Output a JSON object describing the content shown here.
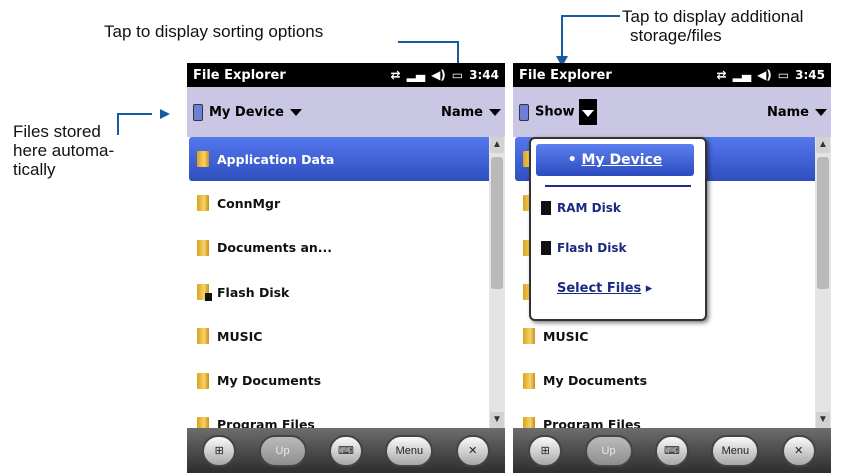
{
  "callouts": {
    "sorting": "Tap to display sorting options",
    "storage_line1": "Tap to display additional",
    "storage_line2": "storage/files",
    "files_line1": "Files stored",
    "files_line2": "here automa-",
    "files_line3": "tically"
  },
  "left_screen": {
    "app_title": "File Explorer",
    "clock": "3:44",
    "location": "My Device",
    "sort": "Name",
    "items": [
      "Application Data",
      "ConnMgr",
      "Documents an...",
      "Flash Disk",
      "MUSIC",
      "My Documents",
      "Program Files"
    ]
  },
  "right_screen": {
    "app_title": "File Explorer",
    "clock": "3:45",
    "show_label": "Show",
    "sort": "Name",
    "items": [
      "MUSIC",
      "My Documents",
      "Program Files"
    ],
    "popup": {
      "selected": "My Device",
      "options": [
        "RAM Disk",
        "Flash Disk"
      ],
      "select_files": "Select Files"
    }
  },
  "softkeys": {
    "up": "Up",
    "menu": "Menu"
  },
  "colors": {
    "header": "#c9c7e3",
    "selection": "#2f4fbf",
    "callout_line": "#1a5aa0"
  },
  "icons": [
    "device-icon",
    "folder-icon",
    "windows-start-icon",
    "keyboard-icon",
    "close-icon",
    "signal-icon",
    "volume-icon",
    "battery-icon"
  ]
}
